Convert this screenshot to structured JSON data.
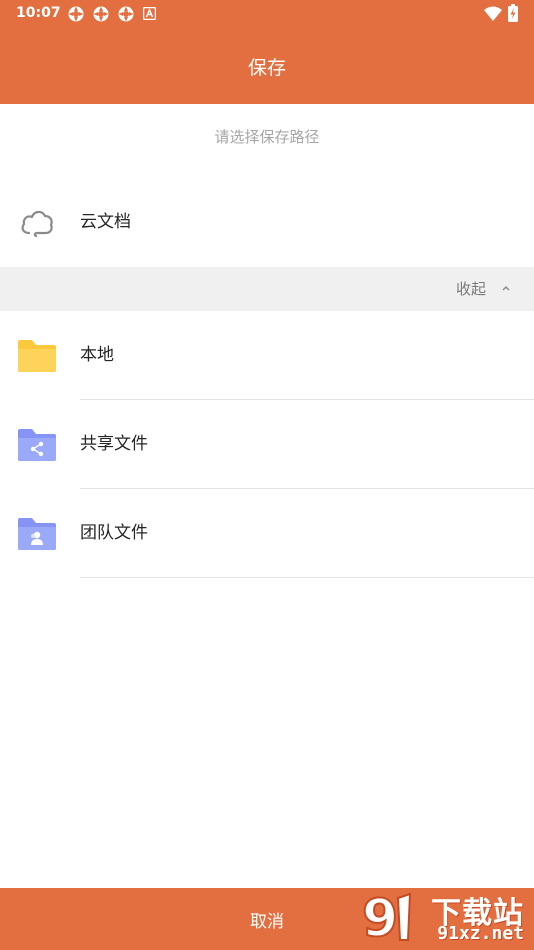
{
  "status_bar": {
    "time": "10:07",
    "notification_icons": [
      "app-notification-icon",
      "app-notification-icon",
      "app-notification-icon",
      "a-icon"
    ],
    "right_icons": [
      "wifi-icon",
      "battery-charging-icon"
    ]
  },
  "app_bar": {
    "title": "保存"
  },
  "subtitle": "请选择保存路径",
  "cloud": {
    "label": "云文档",
    "icon": "cloud-icon"
  },
  "collapse_bar": {
    "label": "收起",
    "icon": "chevron-up-icon"
  },
  "locations": [
    {
      "label": "本地",
      "icon": "folder-icon",
      "color": "#fcc93c"
    },
    {
      "label": "共享文件",
      "icon": "shared-folder-icon",
      "color": "#9aa9f8"
    },
    {
      "label": "团队文件",
      "icon": "team-folder-icon",
      "color": "#9aa9f8"
    }
  ],
  "bottom_bar": {
    "cancel_label": "取消"
  },
  "watermark": {
    "brand": "下载站",
    "site": "91xz.net",
    "logo_text": "9"
  },
  "colors": {
    "accent": "#e36f40",
    "folder_yellow": "#fcc93c",
    "folder_blue": "#9aa9f8"
  }
}
